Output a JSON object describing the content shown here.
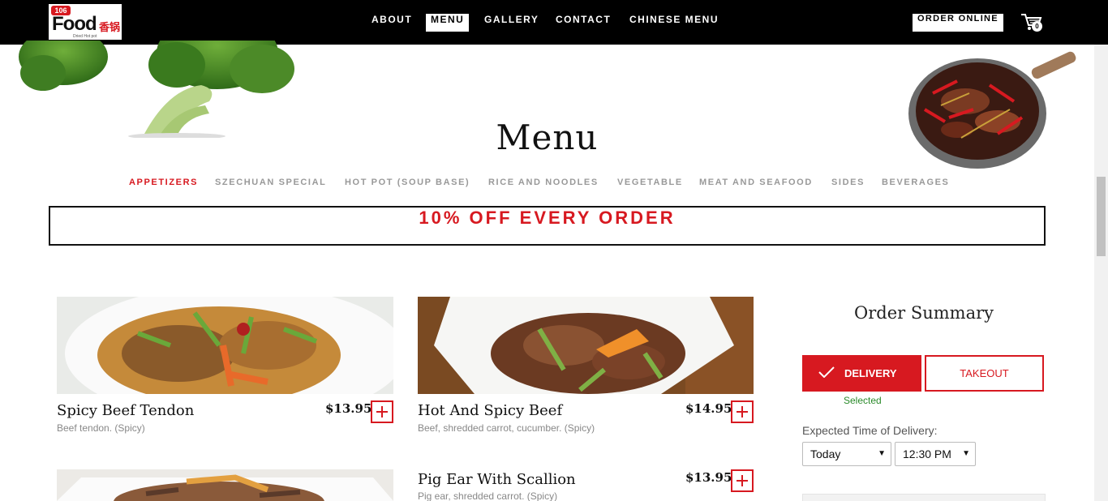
{
  "logo": {
    "number": "106",
    "word": "Food",
    "cn": "香锅",
    "tagline": "Dried Hot pot"
  },
  "nav": {
    "items": [
      {
        "label": "ABOUT"
      },
      {
        "label": "MENU"
      },
      {
        "label": "GALLERY"
      },
      {
        "label": "CONTACT"
      },
      {
        "label": "CHINESE MENU"
      }
    ],
    "active": "MENU",
    "order_online": "ORDER ONLINE",
    "cart_count": "0"
  },
  "page": {
    "title": "Menu"
  },
  "categories": [
    {
      "label": "APPETIZERS",
      "active": true
    },
    {
      "label": "SZECHUAN SPECIAL",
      "active": false
    },
    {
      "label": "HOT POT (SOUP BASE)",
      "active": false
    },
    {
      "label": "RICE AND NOODLES",
      "active": false
    },
    {
      "label": "VEGETABLE",
      "active": false
    },
    {
      "label": "MEAT AND SEAFOOD",
      "active": false
    },
    {
      "label": "SIDES",
      "active": false
    },
    {
      "label": "BEVERAGES",
      "active": false
    }
  ],
  "promo": "10% OFF EVERY ORDER",
  "items": [
    {
      "name": "Spicy Beef Tendon",
      "desc": "Beef tendon. (Spicy)",
      "price": "$13.95"
    },
    {
      "name": "Hot And Spicy Beef",
      "desc": "Beef, shredded carrot, cucumber. (Spicy)",
      "price": "$14.95"
    },
    {
      "name": "Pig Ear With Scallion",
      "desc": "Pig ear, shredded carrot. (Spicy)",
      "price": "$13.95"
    }
  ],
  "order_summary": {
    "title": "Order Summary",
    "delivery": "DELIVERY",
    "takeout": "TAKEOUT",
    "selected": "Selected",
    "time_label": "Expected Time of Delivery:",
    "day": "Today",
    "time": "12:30 PM"
  },
  "colors": {
    "accent": "#d71920",
    "nav_bg": "#000000",
    "selected_green": "#2a8a2a"
  },
  "icons": {
    "cart": "shopping-cart-icon",
    "add": "plus-icon",
    "check": "check-icon",
    "dropdown": "caret-down-icon"
  }
}
